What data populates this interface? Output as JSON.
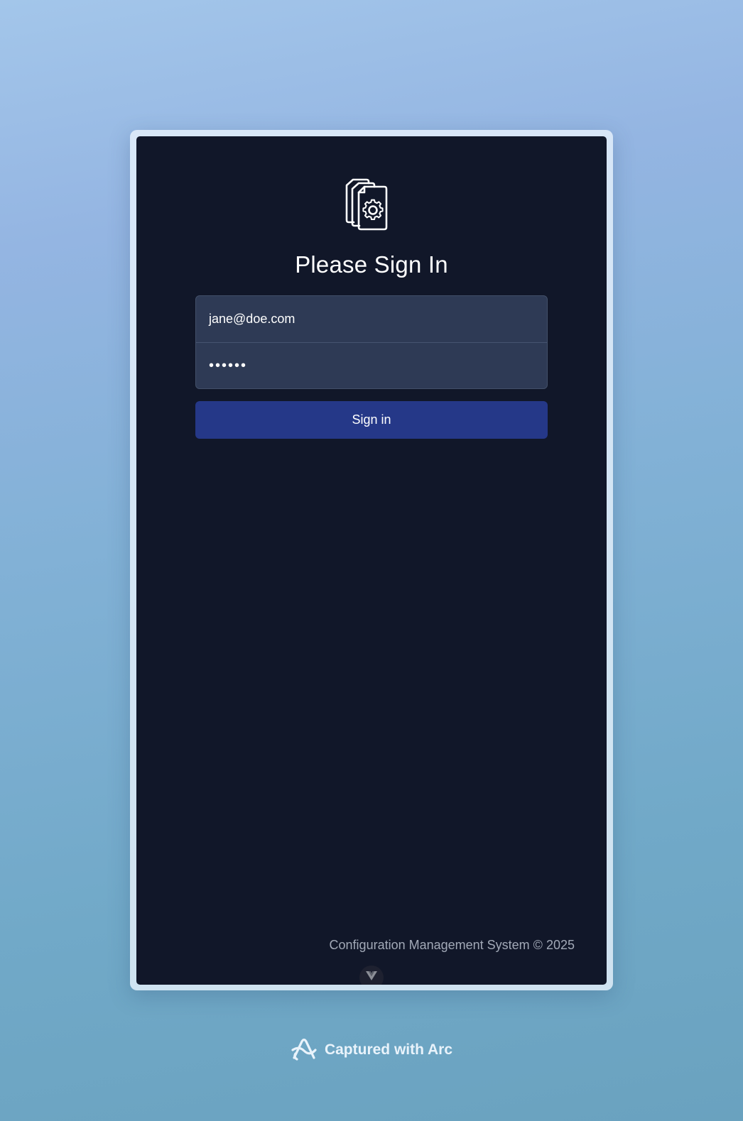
{
  "login": {
    "logo_icon": "config-documents-gear-icon",
    "title": "Please Sign In",
    "email_value": "jane@doe.com",
    "password_value": "••••••",
    "signin_label": "Sign in",
    "footer": "Configuration Management System © 2025"
  },
  "devtools": {
    "icon": "vue-devtools-icon"
  },
  "capture": {
    "label": "Captured with Arc",
    "icon": "arc-logo-icon"
  },
  "colors": {
    "window_bg": "#111729",
    "field_bg": "#2e3a55",
    "button_bg": "#253888",
    "footer_text": "#a2a9b7"
  }
}
